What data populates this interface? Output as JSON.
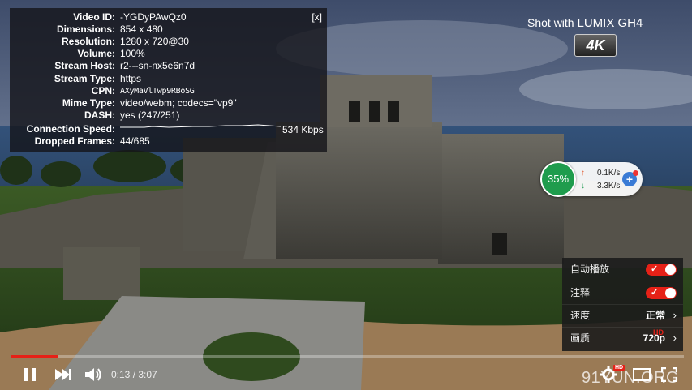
{
  "stats": {
    "close_label": "[x]",
    "rows": [
      {
        "label": "Video ID:",
        "value": "-YGDyPAwQz0"
      },
      {
        "label": "Dimensions:",
        "value": "854 x 480"
      },
      {
        "label": "Resolution:",
        "value": "1280 x 720@30"
      },
      {
        "label": "Volume:",
        "value": "100%"
      },
      {
        "label": "Stream Host:",
        "value": "r2---sn-nx5e6n7d"
      },
      {
        "label": "Stream Type:",
        "value": "https"
      },
      {
        "label": "CPN:",
        "value": "AXyMaVlTwp9RBoSG"
      },
      {
        "label": "Mime Type:",
        "value": "video/webm; codecs=\"vp9\""
      },
      {
        "label": "DASH:",
        "value": "yes (247/251)"
      },
      {
        "label": "Connection Speed:",
        "value": "534 Kbps"
      },
      {
        "label": "Dropped Frames:",
        "value": "44/685"
      }
    ]
  },
  "watermark": {
    "shot_with": "Shot with",
    "brand": "LUMIX GH4",
    "badge": "4K"
  },
  "net_widget": {
    "percent": "35%",
    "up_arrow": "↑",
    "down_arrow": "↓",
    "upload": "0.1K/s",
    "download": "3.3K/s",
    "add": "+"
  },
  "settings_menu": {
    "autoplay_label": "自动播放",
    "annotations_label": "注释",
    "speed_label": "速度",
    "speed_value": "正常",
    "quality_label": "画质",
    "quality_value": "720p",
    "quality_badge": "HD",
    "chevron": "›"
  },
  "player": {
    "current_time": "0:13",
    "duration": "3:07",
    "time_display": "0:13 / 3:07",
    "progress_fraction": 0.07,
    "settings_badge": "HD",
    "accent": "#e62117"
  },
  "site_watermark": "91YUN.ORG"
}
